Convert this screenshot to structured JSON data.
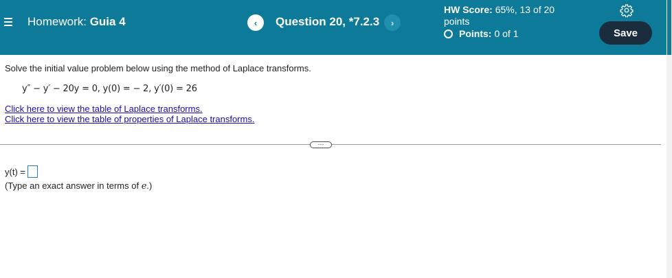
{
  "header": {
    "menu_icon": "hamburger-menu-icon",
    "homework_prefix": "Homework:",
    "homework_name": "Guia 4",
    "prev_glyph": "‹",
    "question_label": "Question 20, *7.2.3",
    "next_glyph": "›",
    "hw_score_label": "HW Score:",
    "hw_score_value": "65%, 13 of 20 points",
    "points_label": "Points:",
    "points_value": "0 of 1",
    "settings_icon": "gear-icon",
    "save_label": "Save",
    "colors": {
      "bar": "#0e7a99",
      "save_button": "#1b2d3d"
    }
  },
  "question": {
    "instruction": "Solve the initial value problem below using the method of Laplace transforms.",
    "equation": "y″ − y′ − 20y = 0, y(0) = − 2, y′(0) = 26",
    "link_transforms": "Click here to view the table of Laplace transforms.",
    "link_properties": "Click here to view the table of properties of Laplace transforms.",
    "expand_glyph": "···"
  },
  "answer": {
    "label": "y(t) =",
    "value": "",
    "hint_prefix": "(Type an exact answer in terms of ",
    "hint_var": "e",
    "hint_suffix": ".)"
  }
}
